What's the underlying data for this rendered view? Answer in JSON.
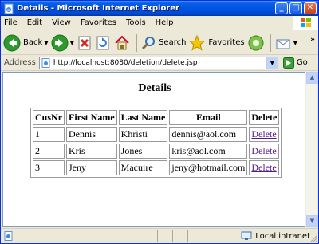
{
  "window": {
    "title": "Details - Microsoft Internet Explorer",
    "minimize": "_",
    "maximize": "□",
    "close": "✕"
  },
  "menu": {
    "items": [
      "File",
      "Edit",
      "View",
      "Favorites",
      "Tools",
      "Help"
    ]
  },
  "toolbar": {
    "back_label": "Back",
    "search_label": "Search",
    "favorites_label": "Favorites"
  },
  "address": {
    "label": "Address",
    "url": "http://localhost:8080/deletion/delete.jsp",
    "go_label": "Go"
  },
  "page": {
    "title": "Details",
    "headers": [
      "CusNr",
      "First Name",
      "Last Name",
      "Email",
      "Delete"
    ],
    "rows": [
      {
        "cusnr": "1",
        "first": "Dennis",
        "last": "Khristi",
        "email": "dennis@aol.com",
        "action": "Delete"
      },
      {
        "cusnr": "2",
        "first": "Kris",
        "last": "Jones",
        "email": "kris@aol.com",
        "action": "Delete"
      },
      {
        "cusnr": "3",
        "first": "Jeny",
        "last": "Macuire",
        "email": "jeny@hotmail.com",
        "action": "Delete"
      }
    ]
  },
  "status": {
    "zone": "Local intranet"
  },
  "icons": {
    "back": "back-arrow-icon",
    "forward": "forward-arrow-icon",
    "stop": "stop-icon",
    "refresh": "refresh-icon",
    "home": "home-icon",
    "search": "search-icon",
    "favorites": "favorites-star-icon",
    "media": "media-icon",
    "mail": "mail-icon"
  }
}
